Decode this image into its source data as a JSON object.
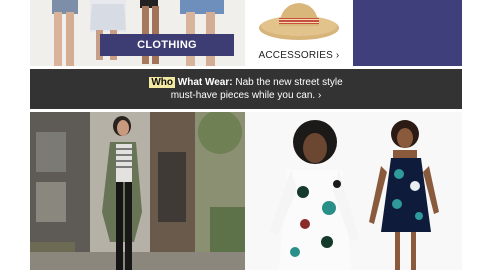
{
  "top_row": {
    "clothing_button": "CLOTHING",
    "accessories_link": "ACCESSORIES ›"
  },
  "banner": {
    "brand_part1": "Who",
    "brand_part2": "What Wear:",
    "line1_text": "Nab the new street style",
    "line2_text": "must-have pieces while you can. ›"
  },
  "colors": {
    "navy": "#3d3d73",
    "banner_bg": "#333333",
    "highlight": "#f4e9a3"
  }
}
